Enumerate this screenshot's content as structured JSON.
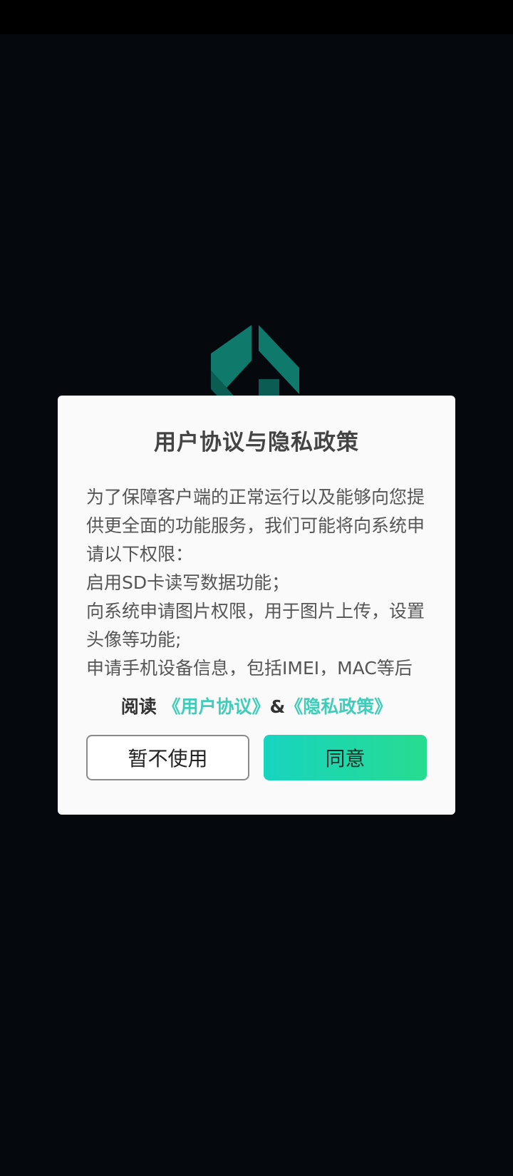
{
  "colors": {
    "background": "#05080c",
    "logo": "#0f7a6c",
    "link": "#3ecdb8",
    "agree_gradient_start": "#18d4c0",
    "agree_gradient_end": "#26dc90"
  },
  "logo": {
    "icon": "app-logo-icon"
  },
  "dialog": {
    "title": "用户协议与隐私政策",
    "body_lines": [
      "为了保障客户端的正常运行以及能够向您提供更全面的功能服务，我们可能将向系统申请以下权限：",
      "启用SD卡读写数据功能；",
      "向系统申请图片权限，用于图片上传，设置头像等功能;",
      "申请手机设备信息，包括IMEI，MAC等后"
    ],
    "read_prefix": "阅读",
    "user_agreement_link": "《用户协议》",
    "ampersand": "&",
    "privacy_policy_link": "《隐私政策》",
    "decline_label": "暂不使用",
    "agree_label": "同意"
  }
}
